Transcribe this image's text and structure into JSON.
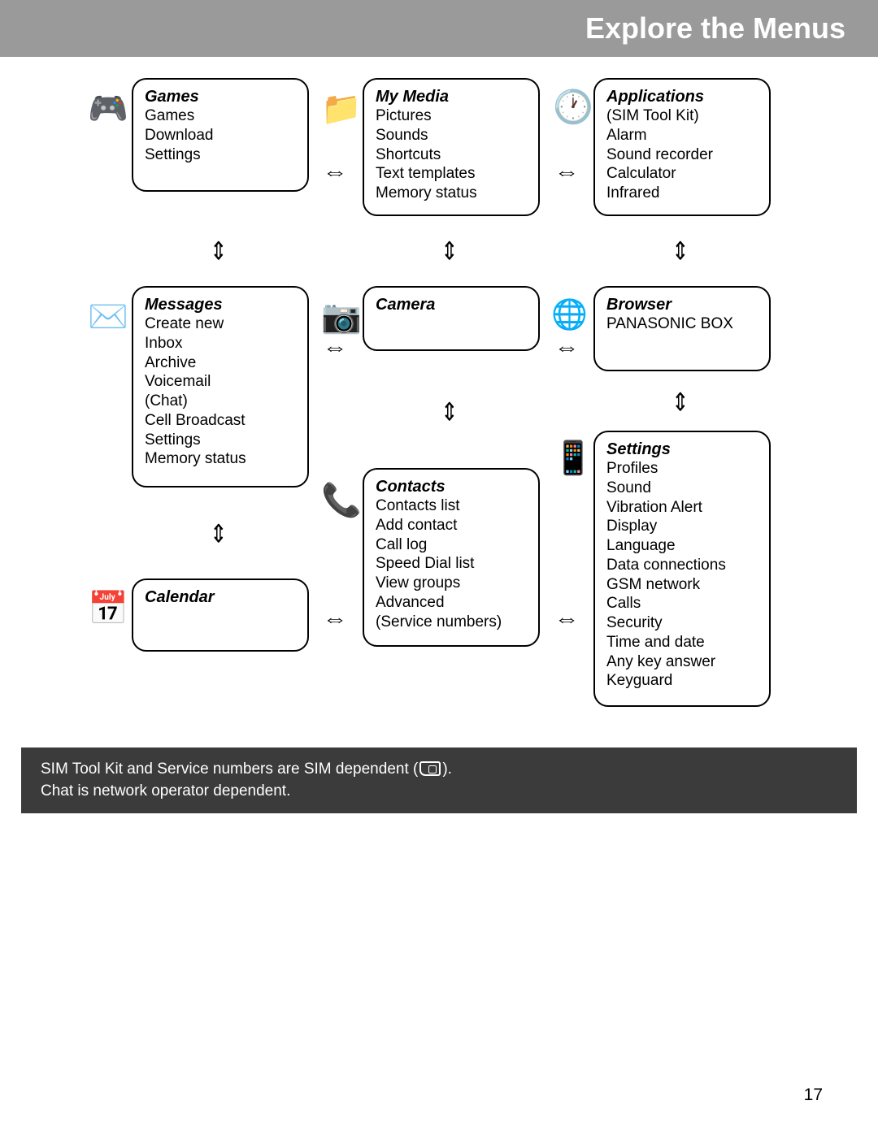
{
  "header_title": "Explore the Menus",
  "page_number": "17",
  "arrows": {
    "h": "⇔",
    "v": "⇕"
  },
  "cards": {
    "games": {
      "title": "Games",
      "items": [
        "Games",
        "Download",
        "Settings"
      ]
    },
    "mymedia": {
      "title": "My Media",
      "items": [
        "Pictures",
        "Sounds",
        "Shortcuts",
        "Text templates",
        "Memory status"
      ]
    },
    "applications": {
      "title": "Applications",
      "items": [
        "(SIM Tool Kit)",
        "Alarm",
        "Sound recorder",
        "Calculator",
        "Infrared"
      ]
    },
    "messages": {
      "title": "Messages",
      "items": [
        "Create new",
        "Inbox",
        "Archive",
        "Voicemail",
        "(Chat)",
        "Cell Broadcast",
        "Settings",
        "Memory status"
      ]
    },
    "camera": {
      "title": "Camera",
      "items": []
    },
    "browser": {
      "title": "Browser",
      "items": [
        "PANASONIC BOX"
      ]
    },
    "calendar": {
      "title": "Calendar",
      "items": []
    },
    "contacts": {
      "title": "Contacts",
      "items": [
        "Contacts list",
        "Add contact",
        "Call log",
        "Speed Dial list",
        "View groups",
        "Advanced",
        "(Service numbers)"
      ]
    },
    "settings": {
      "title": "Settings",
      "items": [
        "Profiles",
        "Sound",
        "Vibration Alert",
        "Display",
        "Language",
        "Data connections",
        "GSM network",
        "Calls",
        "Security",
        "Time and date",
        "Any key answer",
        "Keyguard"
      ]
    }
  },
  "footnote": {
    "line1a": "SIM Tool Kit and Service numbers are SIM dependent (",
    "line1b": ").",
    "line2": "Chat is network operator dependent."
  }
}
